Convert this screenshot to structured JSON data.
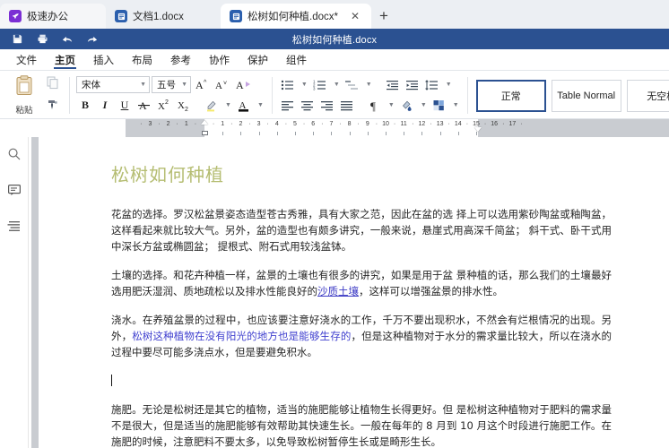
{
  "window": {
    "title": "松树如何种植.docx",
    "titlebar_color": "#2b5191"
  },
  "tabs": [
    {
      "label": "极速办公",
      "icon": "rocket-icon",
      "state": "home",
      "closable": false
    },
    {
      "label": "文档1.docx",
      "icon": "document-icon",
      "state": "inactive",
      "closable": false
    },
    {
      "label": "松树如何种植.docx*",
      "icon": "document-icon",
      "state": "active",
      "closable": true
    }
  ],
  "new_tab_label": "+",
  "quick_access": [
    {
      "name": "save-button",
      "icon": "save-icon"
    },
    {
      "name": "print-button",
      "icon": "print-icon"
    },
    {
      "name": "undo-button",
      "icon": "undo-icon"
    },
    {
      "name": "redo-button",
      "icon": "redo-icon"
    }
  ],
  "menu": {
    "items": [
      {
        "label": "文件",
        "active": false
      },
      {
        "label": "主页",
        "active": true
      },
      {
        "label": "插入",
        "active": false
      },
      {
        "label": "布局",
        "active": false
      },
      {
        "label": "参考",
        "active": false
      },
      {
        "label": "协作",
        "active": false
      },
      {
        "label": "保护",
        "active": false
      },
      {
        "label": "组件",
        "active": false
      }
    ]
  },
  "ribbon": {
    "clipboard": {
      "paste_label": "粘贴",
      "copy_name": "copy-icon",
      "format_painter_name": "format-painter-icon"
    },
    "font": {
      "name_value": "宋体",
      "size_value": "五号",
      "grow_label": "A",
      "shrink_label": "A",
      "clear_format_label": "A",
      "bold_label": "B",
      "italic_label": "I",
      "underline_label": "U",
      "strike_label": "A",
      "superscript_label": "X",
      "subscript_label": "X",
      "highlight_label": "highlight-color-icon",
      "fontcolor_label": "A"
    },
    "paragraph": {
      "bullets": "bullet-list-icon",
      "numbering": "numbered-list-icon",
      "multilevel": "multilevel-list-icon",
      "decrease_indent": "decrease-indent-icon",
      "increase_indent": "increase-indent-icon",
      "line_spacing": "line-spacing-icon",
      "align_left": "align-left-icon",
      "align_center": "align-center-icon",
      "align_right": "align-right-icon",
      "align_justify": "align-justify-icon",
      "show_marks": "pilcrow-icon",
      "shading": "shading-icon",
      "borders": "borders-icon"
    },
    "styles": [
      {
        "label": "正常",
        "selected": true
      },
      {
        "label": "Table Normal",
        "selected": false
      },
      {
        "label": "无空格",
        "selected": false
      }
    ]
  },
  "ruler": {
    "left_labels": [
      "3",
      "2",
      "1"
    ],
    "right_labels": [
      "1",
      "2",
      "3",
      "4",
      "5",
      "6",
      "7",
      "8",
      "9",
      "10",
      "11",
      "12",
      "13",
      "14",
      "15",
      "16",
      "17"
    ]
  },
  "sidebar": {
    "items": [
      {
        "name": "search-icon",
        "label": "查找"
      },
      {
        "name": "comment-icon",
        "label": "批注"
      },
      {
        "name": "outline-icon",
        "label": "目录"
      }
    ]
  },
  "document": {
    "title": "松树如何种植",
    "title_color": "#b5bd72",
    "paragraphs": [
      {
        "id": "p1",
        "runs": [
          {
            "text": "花盆的选择。罗汉松盆景姿态造型苍古秀雅，具有大家之范，因此在盆的选 择上可以选用紫砂陶盆或釉陶盆，这样看起来就比较大气。另外，盆的造型也有颇多讲究，一般来说，悬崖式用高深千简盆；  斜干式、卧干式用中深长方盆或椭圆盆；  提根式、附石式用较浅盆钵。",
            "style": "normal"
          }
        ]
      },
      {
        "id": "p2",
        "runs": [
          {
            "text": "土壤的选择。和花卉种植一样，盆景的土壤也有很多的讲究，如果是用于盆 景种植的话，那么我们的土壤最好选用肥沃湿润、质地疏松以及排水性能良好的",
            "style": "normal"
          },
          {
            "text": "沙质土壤",
            "style": "link"
          },
          {
            "text": "，这样可以增强盆景的排水性。",
            "style": "normal"
          }
        ]
      },
      {
        "id": "p3",
        "runs": [
          {
            "text": "浇水。在养殖盆景的过程中，也应该要注意好浇水的工作，千万不要出现积水，不然会有烂根情况的出现。另外，",
            "style": "normal"
          },
          {
            "text": "松树这种植物在没有阳光的地方也是能够生存的",
            "style": "blue"
          },
          {
            "text": "，但是这种植物对于水分的需求量比较大，所以在浇水的过程中要尽可能多浇点水，但是要避免积水。",
            "style": "normal"
          }
        ]
      },
      {
        "id": "p4",
        "runs": [
          {
            "text": "施肥。无论是松树还是其它的植物，适当的施肥能够让植物生长得更好。但 是松树这种植物对于肥料的需求量不是很大，但是适当的施肥能够有效帮助其快速生长。一般在每年的 8 月到 10 月这个时段进行施肥工作。在施肥的时候，注意肥料不要太多，以免导致松树暂停生长或是畸形生长。",
            "style": "normal"
          }
        ]
      }
    ],
    "caret_visible": true
  }
}
